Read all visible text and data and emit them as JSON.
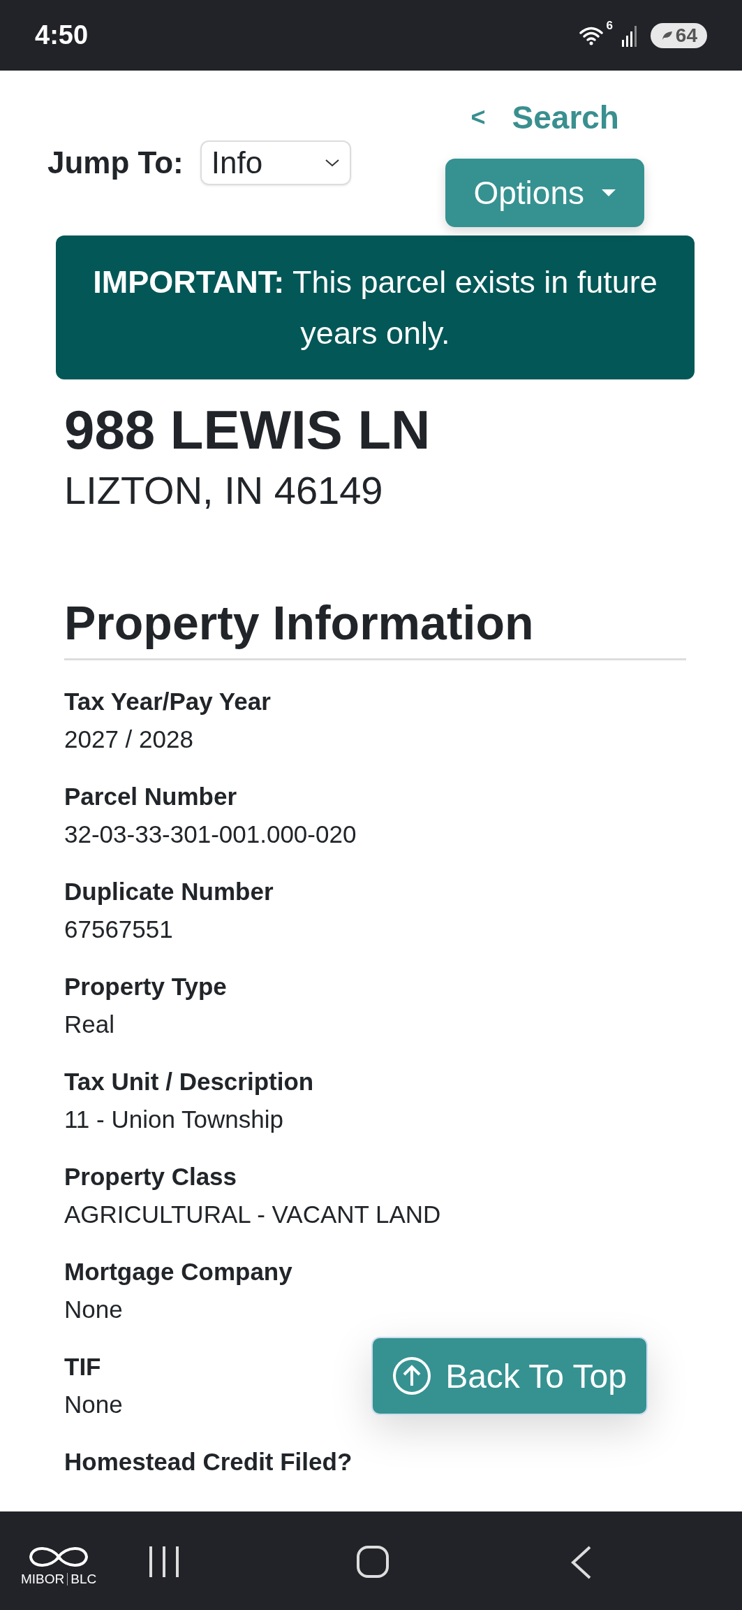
{
  "status_bar": {
    "time": "4:50",
    "wifi_badge": "6",
    "battery": "64"
  },
  "header": {
    "search_link": "Search",
    "back_glyph": "<",
    "jump_label": "Jump To:",
    "jump_value": "Info",
    "options_button": "Options"
  },
  "notice": "**IMPORTANT:** This parcel exists in future years only.",
  "address": {
    "street": "988 LEWIS LN",
    "city": "LIZTON, IN 46149"
  },
  "section_title": "Property Information",
  "fields": [
    {
      "label": "Tax Year/Pay Year",
      "value": "2027 / 2028"
    },
    {
      "label": "Parcel Number",
      "value": "32-03-33-301-001.000-020"
    },
    {
      "label": "Duplicate Number",
      "value": "67567551"
    },
    {
      "label": "Property Type",
      "value": "Real"
    },
    {
      "label": "Tax Unit / Description",
      "value": "11 - Union Township"
    },
    {
      "label": "Property Class",
      "value": "AGRICULTURAL - VACANT LAND"
    },
    {
      "label": "Mortgage Company",
      "value": "None"
    },
    {
      "label": "TIF",
      "value": "None"
    },
    {
      "label": "Homestead Credit Filed?"
    }
  ],
  "back_to_top": "Back To Top",
  "nav_bar": {
    "logo_left": "MIBOR",
    "logo_right": "BLC"
  }
}
